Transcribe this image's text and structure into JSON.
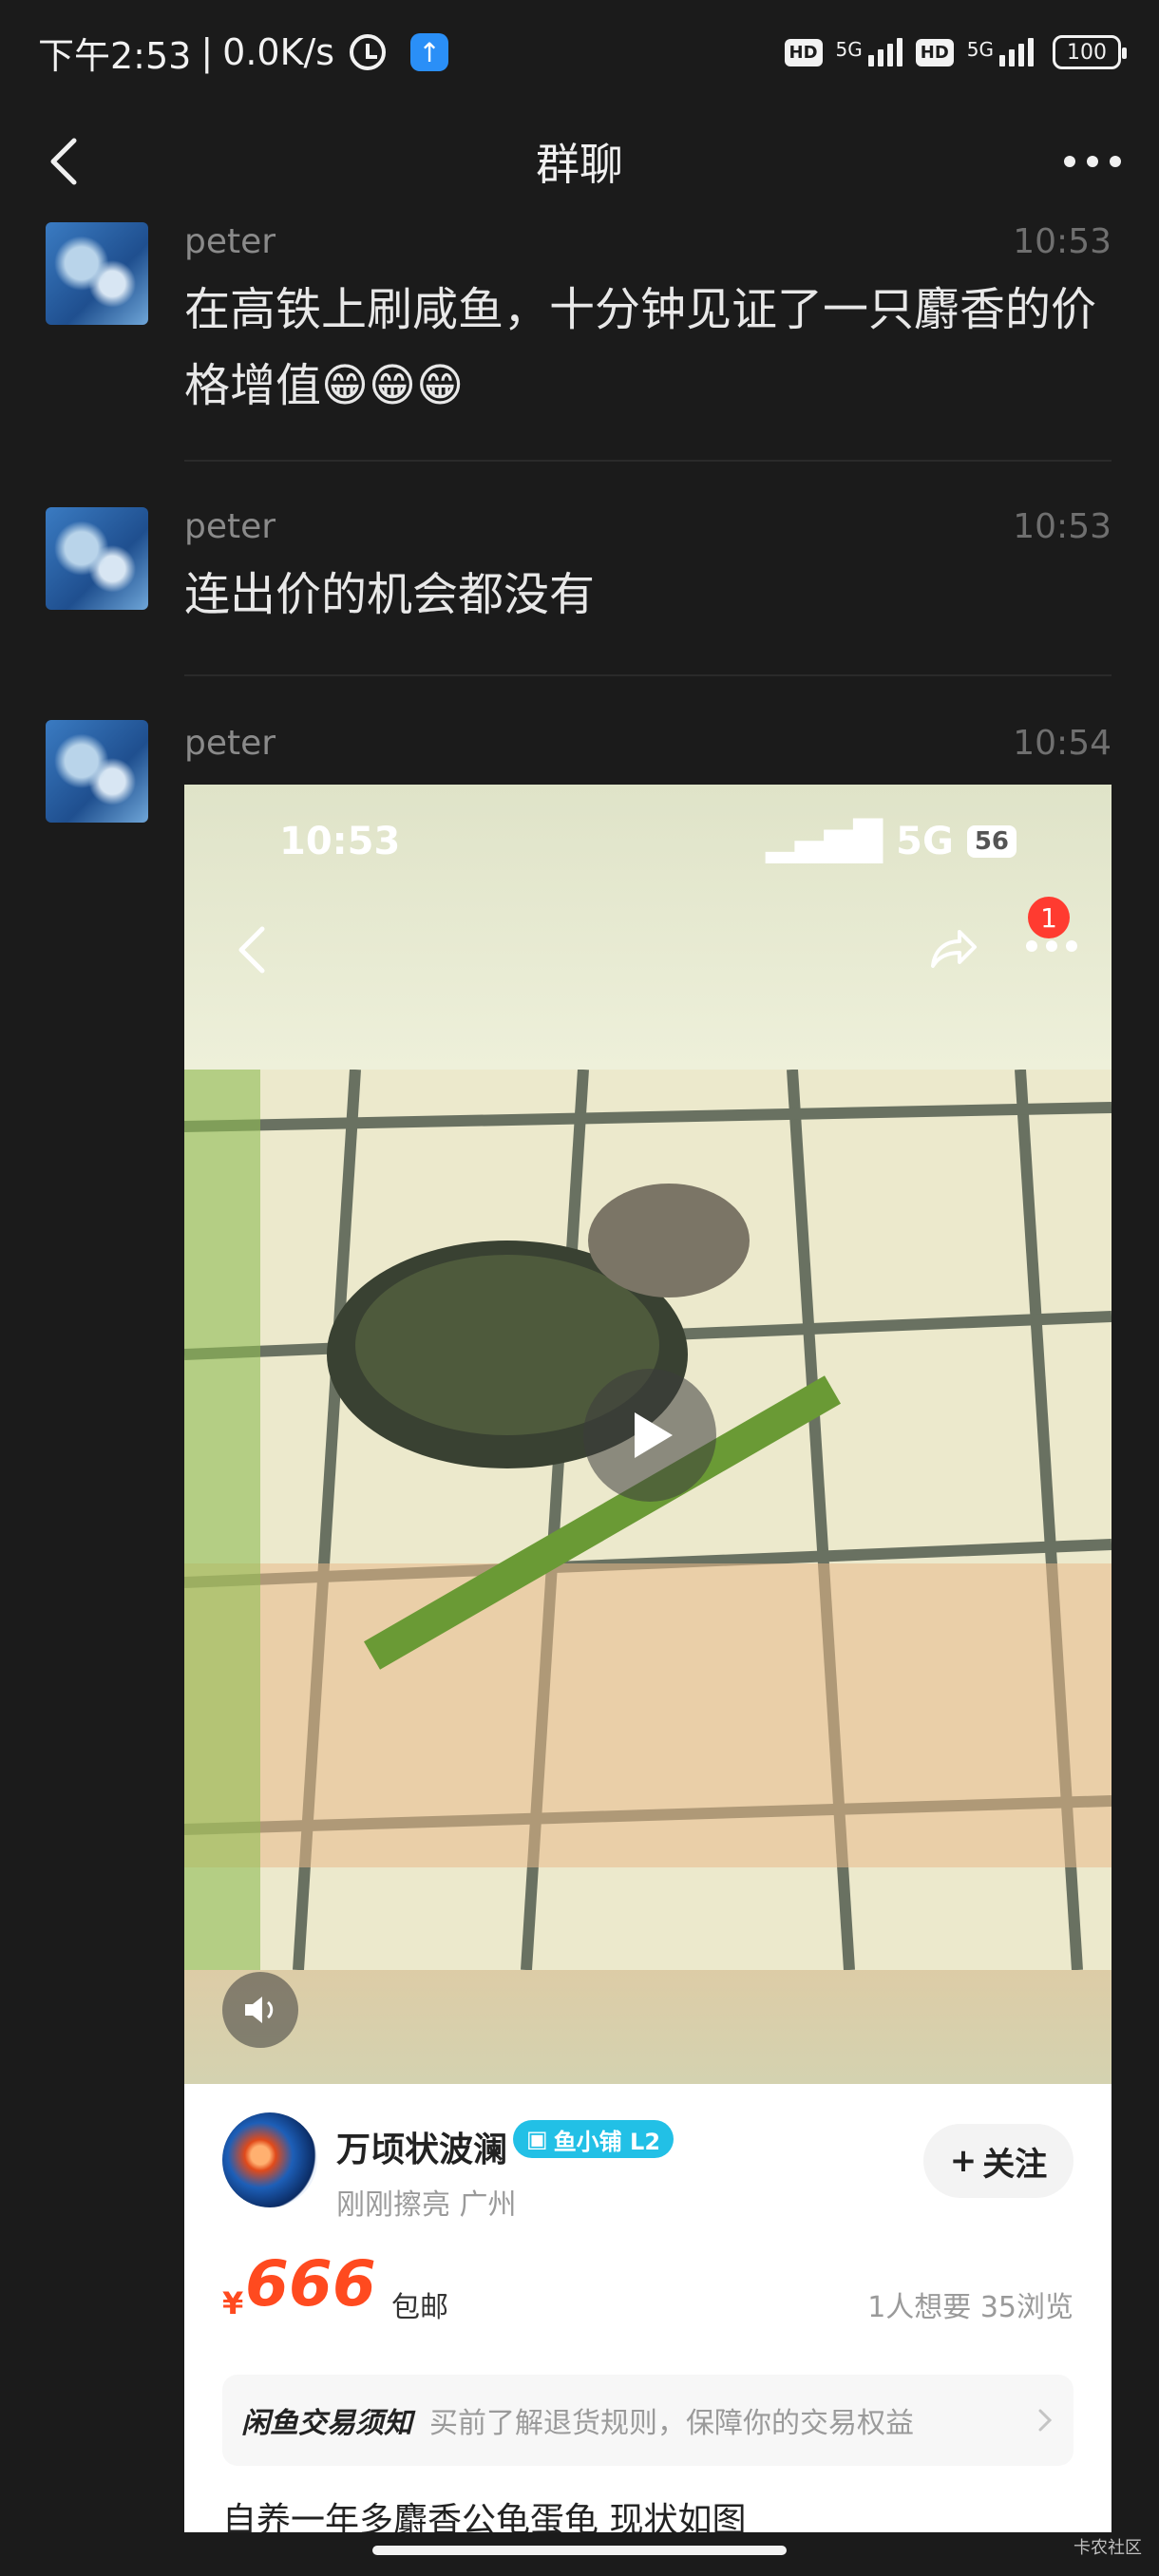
{
  "status_bar": {
    "time": "下午2:53",
    "net_speed": "0.0K/s",
    "sim1_hd": "HD",
    "sim1_net": "5G",
    "sim2_hd": "HD",
    "sim2_net": "5G",
    "battery": "100",
    "icons": [
      "alarm-icon",
      "app-notification-icon",
      "signal-icon",
      "battery-icon"
    ]
  },
  "nav": {
    "title": "群聊",
    "back_icon": "chevron-left-icon",
    "more_icon": "more-dots-icon"
  },
  "messages": [
    {
      "sender": "peter",
      "time": "10:53",
      "text": "在高铁上刷咸鱼，十分钟见证了一只麝香的价格增值😁😁😁"
    },
    {
      "sender": "peter",
      "time": "10:53",
      "text": "连出价的机会都没有"
    },
    {
      "sender": "peter",
      "time": "10:54"
    }
  ],
  "shared_card": {
    "video": {
      "time": "10:53",
      "network": "5G",
      "battery": "56",
      "badge_count": "1",
      "icons": [
        "back-icon",
        "share-icon",
        "more-dots-icon",
        "play-icon",
        "volume-icon"
      ]
    },
    "seller": {
      "name": "万顷状波澜",
      "tag": "鱼小铺 L2",
      "sub": "刚刚擦亮  广州",
      "follow": "关注"
    },
    "price_symbol": "¥",
    "price": "666",
    "shipping": "包邮",
    "stats": "1人想要  35浏览",
    "notice": {
      "title": "闲鱼交易须知",
      "text": "买前了解退货规则，保障你的交易权益"
    },
    "description": "自养一年多麝香公龟蛋龟 现状如图"
  },
  "watermark": "卡农社区"
}
